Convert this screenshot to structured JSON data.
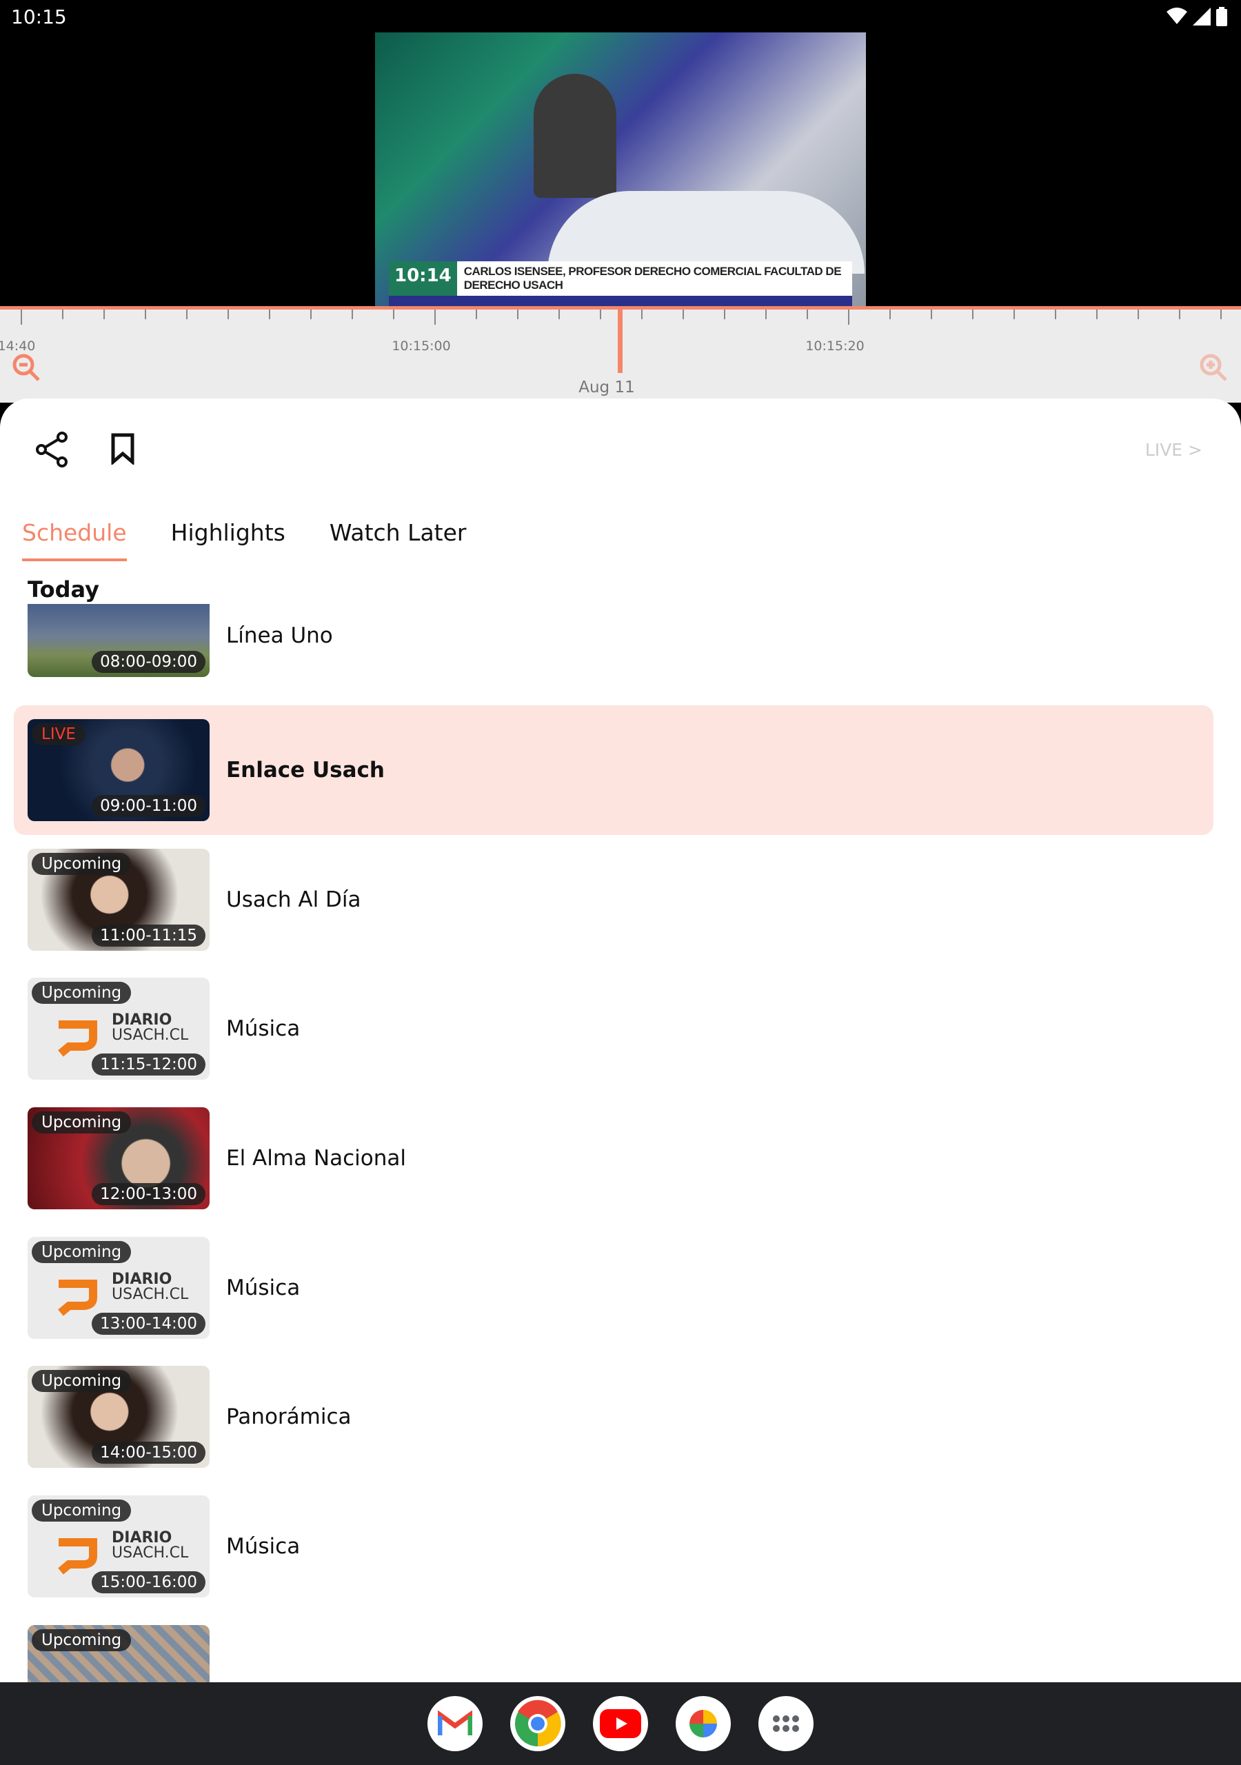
{
  "status": {
    "time": "10:15",
    "icons": [
      "wifi-icon",
      "signal-icon",
      "battery-icon"
    ]
  },
  "video": {
    "clock": "10:14",
    "caption": "CARLOS ISENSEE, PROFESOR DERECHO COMERCIAL FACULTAD DE DERECHO USACH"
  },
  "timeline": {
    "labels": [
      "14:40",
      "10:15:00",
      "10:15:20"
    ],
    "date": "Aug 11",
    "accent": "#f5866a"
  },
  "actions": {
    "live_link": "LIVE >"
  },
  "tabs": [
    {
      "label": "Schedule",
      "active": true
    },
    {
      "label": "Highlights"
    },
    {
      "label": "Watch Later"
    }
  ],
  "section": "Today",
  "schedule": [
    {
      "title": "Línea Uno",
      "time": "08:00-09:00",
      "status": "",
      "thumb": "person"
    },
    {
      "title": "Enlace Usach",
      "time": "09:00-11:00",
      "status": "LIVE",
      "thumb": "person-dark"
    },
    {
      "title": "Usach Al Día",
      "time": "11:00-11:15",
      "status": "Upcoming",
      "thumb": "woman"
    },
    {
      "title": "Música",
      "time": "11:15-12:00",
      "status": "Upcoming",
      "thumb": "logo"
    },
    {
      "title": "El Alma Nacional",
      "time": "12:00-13:00",
      "status": "Upcoming",
      "thumb": "red"
    },
    {
      "title": "Música",
      "time": "13:00-14:00",
      "status": "Upcoming",
      "thumb": "logo"
    },
    {
      "title": "Panorámica",
      "time": "14:00-15:00",
      "status": "Upcoming",
      "thumb": "woman"
    },
    {
      "title": "Música",
      "time": "15:00-16:00",
      "status": "Upcoming",
      "thumb": "logo"
    },
    {
      "title": "",
      "time": "",
      "status": "Upcoming",
      "thumb": "pattern"
    }
  ],
  "logo_text": {
    "line1": "DIARIO",
    "line2": "USACH.CL"
  },
  "nav_apps": [
    "gmail-icon",
    "chrome-icon",
    "youtube-icon",
    "photos-icon",
    "app-drawer-icon"
  ]
}
